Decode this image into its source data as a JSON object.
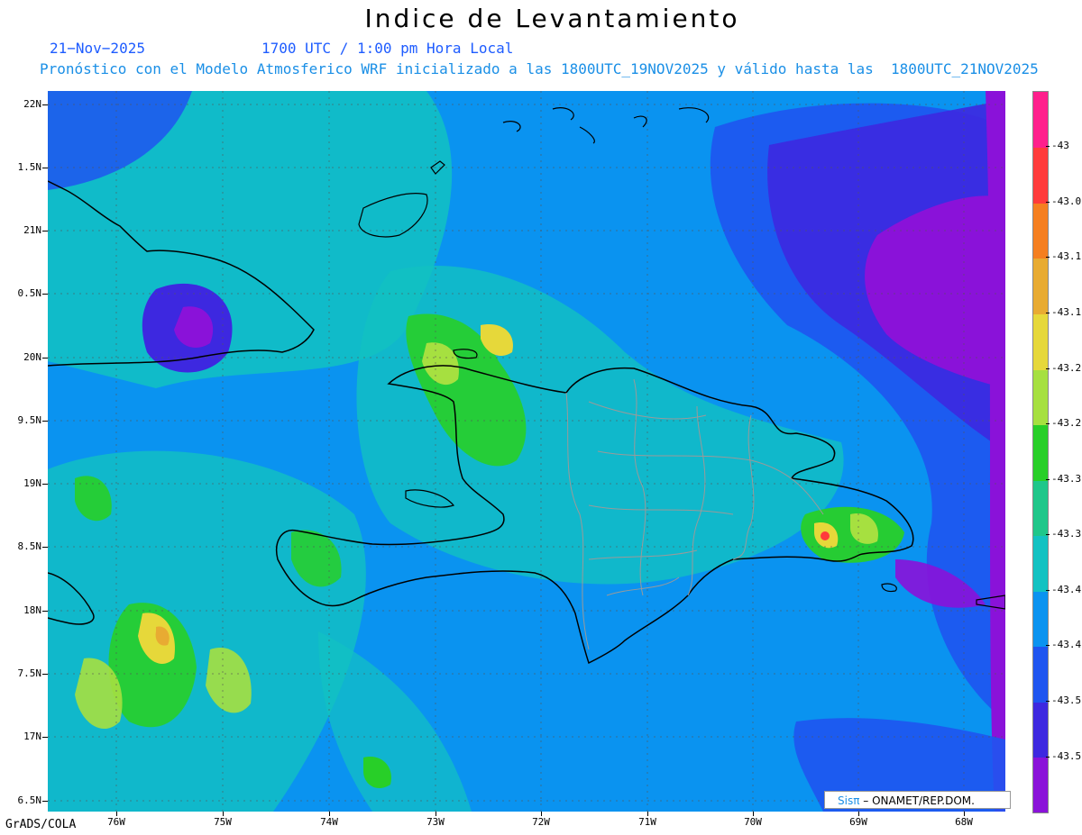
{
  "header": {
    "title": "Indice de Levantamiento",
    "date": "21−Nov−2025",
    "time": "1700 UTC / 1:00 pm Hora Local",
    "description": "Pronóstico con el Modelo Atmosferico WRF inicializado a las 1800UTC_19NOV2025 y válido hasta las  1800UTC_21NOV2025"
  },
  "axes": {
    "lat_labels": [
      "22N",
      "1.5N",
      "21N",
      "0.5N",
      "20N",
      "9.5N",
      "19N",
      "8.5N",
      "18N",
      "7.5N",
      "17N",
      "6.5N"
    ],
    "lon_labels": [
      "76W",
      "75W",
      "74W",
      "73W",
      "72W",
      "71W",
      "70W",
      "69W",
      "68W"
    ]
  },
  "colorbar": {
    "labels": [
      "-43",
      "-43.0",
      "-43.1",
      "-43.1",
      "-43.2",
      "-43.2",
      "-43.3",
      "-43.3",
      "-43.4",
      "-43.4",
      "-43.5",
      "-43.5"
    ],
    "colors": [
      "#ff1f8c",
      "#ff3b3b",
      "#f57f20",
      "#e8ab32",
      "#e6d83a",
      "#a6e040",
      "#28cf28",
      "#1fc78a",
      "#12c2c2",
      "#0a93f0",
      "#1e55f0",
      "#3d28e0",
      "#8a12d9"
    ]
  },
  "footer": {
    "source": "GrADS/COLA",
    "credit_brand": "Sisπ",
    "credit_org": "– ONAMET/REP.DOM."
  }
}
